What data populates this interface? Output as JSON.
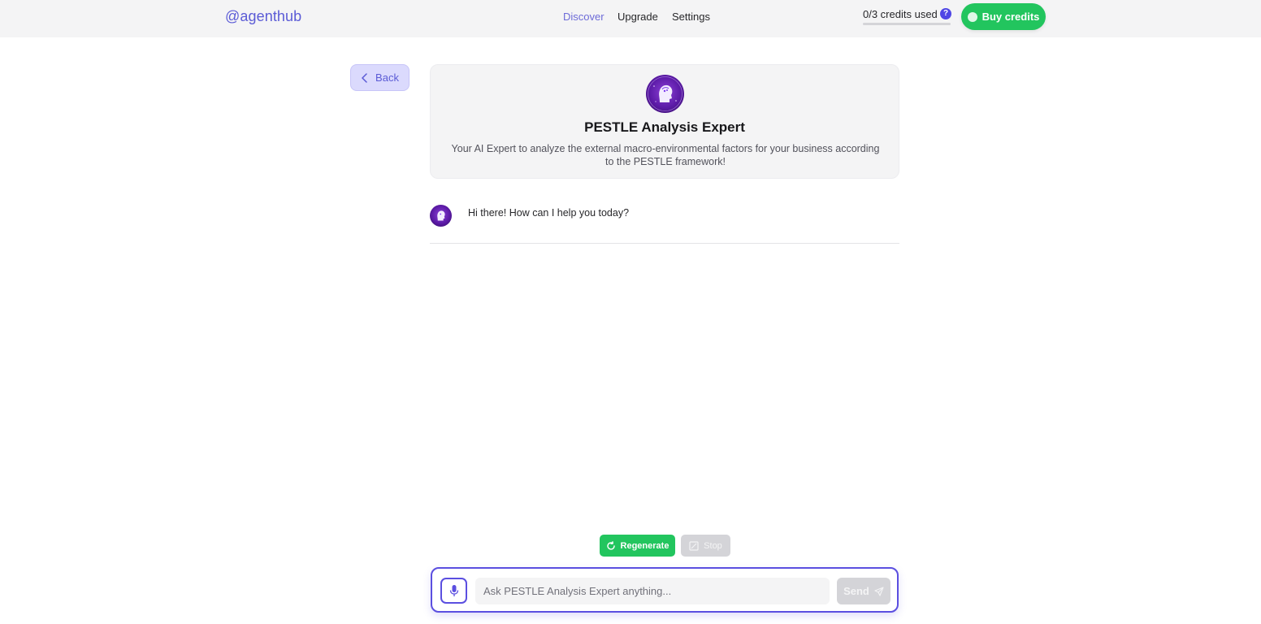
{
  "header": {
    "logo": "@agenthub",
    "nav": [
      {
        "label": "Discover",
        "active": true
      },
      {
        "label": "Upgrade",
        "active": false
      },
      {
        "label": "Settings",
        "active": false
      }
    ],
    "credits_text": "0/3 credits used",
    "credits_used_fraction": 0,
    "help_glyph": "?",
    "buy_label": "Buy credits"
  },
  "back_label": "Back",
  "agent": {
    "name": "PESTLE Analysis Expert",
    "description": "Your AI Expert to analyze the external macro-environmental factors for your business according to the PESTLE framework!"
  },
  "messages": [
    {
      "role": "assistant",
      "text": "Hi there! How can I help you today?"
    }
  ],
  "actions": {
    "regenerate_label": "Regenerate",
    "stop_label": "Stop"
  },
  "composer": {
    "placeholder": "Ask PESTLE Analysis Expert anything...",
    "value": "",
    "send_label": "Send"
  },
  "colors": {
    "accent": "#5b5bd6",
    "green": "#22c55e",
    "disabled": "#d4d4d8"
  }
}
